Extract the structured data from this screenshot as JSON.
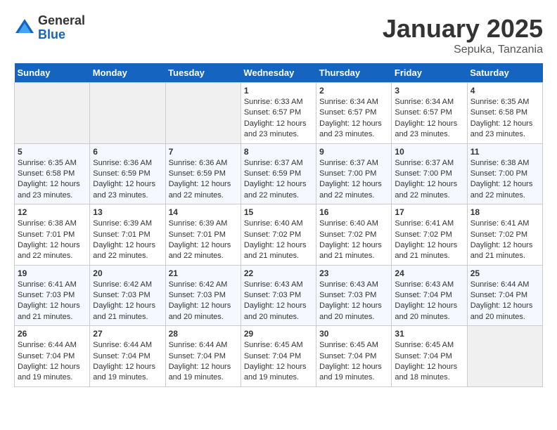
{
  "logo": {
    "general": "General",
    "blue": "Blue"
  },
  "title": "January 2025",
  "location": "Sepuka, Tanzania",
  "weekdays": [
    "Sunday",
    "Monday",
    "Tuesday",
    "Wednesday",
    "Thursday",
    "Friday",
    "Saturday"
  ],
  "weeks": [
    [
      {
        "day": "",
        "empty": true
      },
      {
        "day": "",
        "empty": true
      },
      {
        "day": "",
        "empty": true
      },
      {
        "day": "1",
        "sunrise": "6:33 AM",
        "sunset": "6:57 PM",
        "daylight": "12 hours and 23 minutes."
      },
      {
        "day": "2",
        "sunrise": "6:34 AM",
        "sunset": "6:57 PM",
        "daylight": "12 hours and 23 minutes."
      },
      {
        "day": "3",
        "sunrise": "6:34 AM",
        "sunset": "6:57 PM",
        "daylight": "12 hours and 23 minutes."
      },
      {
        "day": "4",
        "sunrise": "6:35 AM",
        "sunset": "6:58 PM",
        "daylight": "12 hours and 23 minutes."
      }
    ],
    [
      {
        "day": "5",
        "sunrise": "6:35 AM",
        "sunset": "6:58 PM",
        "daylight": "12 hours and 23 minutes."
      },
      {
        "day": "6",
        "sunrise": "6:36 AM",
        "sunset": "6:59 PM",
        "daylight": "12 hours and 23 minutes."
      },
      {
        "day": "7",
        "sunrise": "6:36 AM",
        "sunset": "6:59 PM",
        "daylight": "12 hours and 22 minutes."
      },
      {
        "day": "8",
        "sunrise": "6:37 AM",
        "sunset": "6:59 PM",
        "daylight": "12 hours and 22 minutes."
      },
      {
        "day": "9",
        "sunrise": "6:37 AM",
        "sunset": "7:00 PM",
        "daylight": "12 hours and 22 minutes."
      },
      {
        "day": "10",
        "sunrise": "6:37 AM",
        "sunset": "7:00 PM",
        "daylight": "12 hours and 22 minutes."
      },
      {
        "day": "11",
        "sunrise": "6:38 AM",
        "sunset": "7:00 PM",
        "daylight": "12 hours and 22 minutes."
      }
    ],
    [
      {
        "day": "12",
        "sunrise": "6:38 AM",
        "sunset": "7:01 PM",
        "daylight": "12 hours and 22 minutes."
      },
      {
        "day": "13",
        "sunrise": "6:39 AM",
        "sunset": "7:01 PM",
        "daylight": "12 hours and 22 minutes."
      },
      {
        "day": "14",
        "sunrise": "6:39 AM",
        "sunset": "7:01 PM",
        "daylight": "12 hours and 22 minutes."
      },
      {
        "day": "15",
        "sunrise": "6:40 AM",
        "sunset": "7:02 PM",
        "daylight": "12 hours and 21 minutes."
      },
      {
        "day": "16",
        "sunrise": "6:40 AM",
        "sunset": "7:02 PM",
        "daylight": "12 hours and 21 minutes."
      },
      {
        "day": "17",
        "sunrise": "6:41 AM",
        "sunset": "7:02 PM",
        "daylight": "12 hours and 21 minutes."
      },
      {
        "day": "18",
        "sunrise": "6:41 AM",
        "sunset": "7:02 PM",
        "daylight": "12 hours and 21 minutes."
      }
    ],
    [
      {
        "day": "19",
        "sunrise": "6:41 AM",
        "sunset": "7:03 PM",
        "daylight": "12 hours and 21 minutes."
      },
      {
        "day": "20",
        "sunrise": "6:42 AM",
        "sunset": "7:03 PM",
        "daylight": "12 hours and 21 minutes."
      },
      {
        "day": "21",
        "sunrise": "6:42 AM",
        "sunset": "7:03 PM",
        "daylight": "12 hours and 20 minutes."
      },
      {
        "day": "22",
        "sunrise": "6:43 AM",
        "sunset": "7:03 PM",
        "daylight": "12 hours and 20 minutes."
      },
      {
        "day": "23",
        "sunrise": "6:43 AM",
        "sunset": "7:03 PM",
        "daylight": "12 hours and 20 minutes."
      },
      {
        "day": "24",
        "sunrise": "6:43 AM",
        "sunset": "7:04 PM",
        "daylight": "12 hours and 20 minutes."
      },
      {
        "day": "25",
        "sunrise": "6:44 AM",
        "sunset": "7:04 PM",
        "daylight": "12 hours and 20 minutes."
      }
    ],
    [
      {
        "day": "26",
        "sunrise": "6:44 AM",
        "sunset": "7:04 PM",
        "daylight": "12 hours and 19 minutes."
      },
      {
        "day": "27",
        "sunrise": "6:44 AM",
        "sunset": "7:04 PM",
        "daylight": "12 hours and 19 minutes."
      },
      {
        "day": "28",
        "sunrise": "6:44 AM",
        "sunset": "7:04 PM",
        "daylight": "12 hours and 19 minutes."
      },
      {
        "day": "29",
        "sunrise": "6:45 AM",
        "sunset": "7:04 PM",
        "daylight": "12 hours and 19 minutes."
      },
      {
        "day": "30",
        "sunrise": "6:45 AM",
        "sunset": "7:04 PM",
        "daylight": "12 hours and 19 minutes."
      },
      {
        "day": "31",
        "sunrise": "6:45 AM",
        "sunset": "7:04 PM",
        "daylight": "12 hours and 18 minutes."
      },
      {
        "day": "",
        "empty": true
      }
    ]
  ],
  "labels": {
    "sunrise": "Sunrise:",
    "sunset": "Sunset:",
    "daylight": "Daylight:"
  }
}
